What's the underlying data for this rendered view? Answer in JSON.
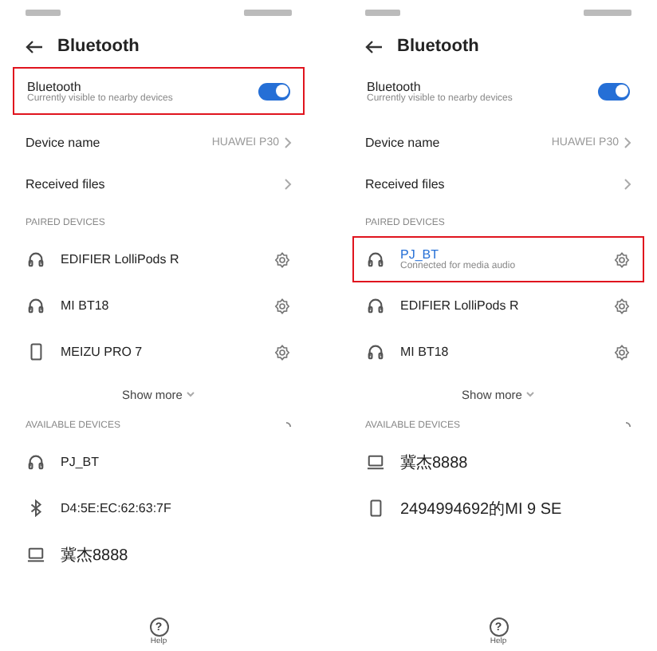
{
  "screens": [
    {
      "title": "Bluetooth",
      "bluetooth": {
        "label": "Bluetooth",
        "subtitle": "Currently visible to nearby devices",
        "on": true,
        "highlighted": true
      },
      "device_name": {
        "label": "Device name",
        "value": "HUAWEI P30"
      },
      "received_files": {
        "label": "Received files"
      },
      "paired_header": "PAIRED DEVICES",
      "paired": [
        {
          "kind": "headphones",
          "name": "EDIFIER LolliPods R",
          "highlighted": false
        },
        {
          "kind": "headphones",
          "name": "MI BT18",
          "highlighted": false
        },
        {
          "kind": "phone",
          "name": "MEIZU PRO 7",
          "highlighted": false
        }
      ],
      "show_more": "Show more",
      "available_header": "AVAILABLE DEVICES",
      "available": [
        {
          "kind": "headphones",
          "name": "PJ_BT"
        },
        {
          "kind": "bluetooth",
          "name": "D4:5E:EC:62:63:7F"
        },
        {
          "kind": "laptop",
          "name": "冀杰8888"
        }
      ],
      "help": {
        "icon": "?",
        "label": "Help"
      }
    },
    {
      "title": "Bluetooth",
      "bluetooth": {
        "label": "Bluetooth",
        "subtitle": "Currently visible to nearby devices",
        "on": true,
        "highlighted": false
      },
      "device_name": {
        "label": "Device name",
        "value": "HUAWEI P30"
      },
      "received_files": {
        "label": "Received files"
      },
      "paired_header": "PAIRED DEVICES",
      "paired": [
        {
          "kind": "headphones",
          "name": "PJ_BT",
          "subtitle": "Connected for media audio",
          "highlighted": true
        },
        {
          "kind": "headphones",
          "name": "EDIFIER LolliPods R",
          "highlighted": false
        },
        {
          "kind": "headphones",
          "name": "MI BT18",
          "highlighted": false
        }
      ],
      "show_more": "Show more",
      "available_header": "AVAILABLE DEVICES",
      "available": [
        {
          "kind": "laptop",
          "name": "冀杰8888"
        },
        {
          "kind": "phone",
          "name": "2494994692的MI 9 SE"
        }
      ],
      "help": {
        "icon": "?",
        "label": "Help"
      }
    }
  ]
}
